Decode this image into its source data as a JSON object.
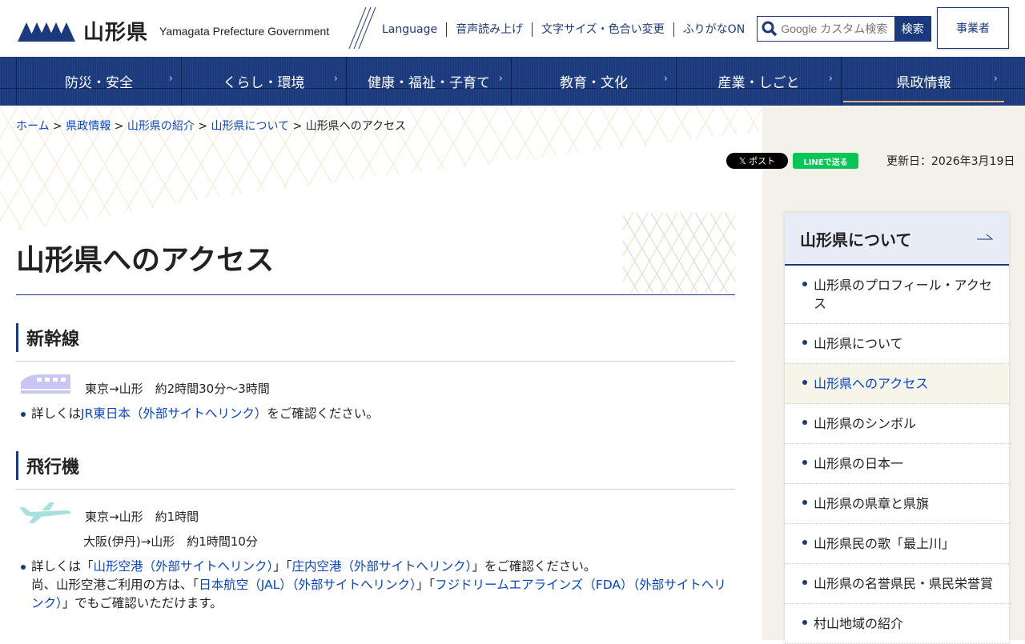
{
  "header": {
    "logo_jp": "山形県",
    "logo_en": "Yamagata Prefecture Government",
    "util": [
      "Language",
      "音声読み上げ",
      "文字サイズ・色合い変更",
      "ふりがなON"
    ],
    "search_placeholder": "Google カスタム検索",
    "search_button": "検索",
    "business": "事業者"
  },
  "nav": [
    {
      "label": "防災・安全"
    },
    {
      "label": "くらし・環境"
    },
    {
      "label": "健康・福祉・子育て"
    },
    {
      "label": "教育・文化"
    },
    {
      "label": "産業・しごと"
    },
    {
      "label": "県政情報",
      "active": true
    }
  ],
  "breadcrumb": {
    "items": [
      "ホーム",
      "県政情報",
      "山形県の紹介",
      "山形県について"
    ],
    "current": "山形県へのアクセス",
    "sep": ">"
  },
  "social": {
    "x": "𝕏 ポスト",
    "line": "LINEで送る"
  },
  "updated": "更新日：2026年3月19日",
  "page_title": "山形県へのアクセス",
  "sections": [
    {
      "heading": "新幹線",
      "routes": [
        "東京→山形　約2時間30分～3時間"
      ],
      "note": {
        "pre": "詳しくは",
        "link": "JR東日本（外部サイトへリンク）",
        "post": "をご確認ください。"
      }
    },
    {
      "heading": "飛行機",
      "routes": [
        "東京→山形　約1時間",
        "大阪(伊丹)→山形　約1時間10分"
      ],
      "note": {
        "pre": "詳しくは「",
        "link1": "山形空港（外部サイトへリンク）",
        "mid1": "」「",
        "link2": "庄内空港（外部サイトへリンク）",
        "mid2": "」をご確認ください。",
        "line2_pre": "尚、山形空港ご利用の方は、「",
        "link3": "日本航空（JAL）（外部サイトへリンク）",
        "mid3": "」「",
        "link4": "フジドリームエアラインズ（FDA）（外部サイトへリンク）",
        "post": "」でもご確認いただけます。"
      }
    }
  ],
  "sidebar": {
    "title": "山形県について",
    "items": [
      "山形県のプロフィール・アクセス",
      "山形県について",
      "山形県へのアクセス",
      "山形県のシンボル",
      "山形県の日本一",
      "山形県の県章と県旗",
      "山形県民の歌「最上川」",
      "山形県の名誉県民・県民栄誉賞",
      "村山地域の紹介"
    ],
    "current_index": 2
  },
  "colors": {
    "brand": "#1b3a7d",
    "accent": "#e8b46a"
  }
}
